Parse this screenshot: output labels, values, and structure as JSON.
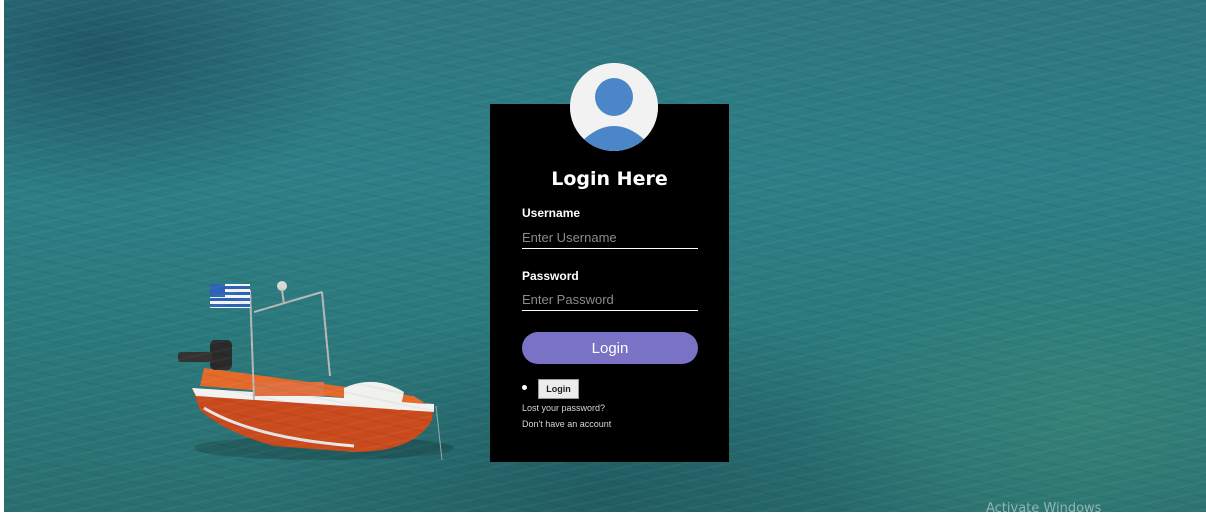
{
  "login": {
    "title": "Login Here",
    "username_label": "Username",
    "username_placeholder": "Enter Username",
    "password_label": "Password",
    "password_placeholder": "Enter Password",
    "submit_label": "Login",
    "secondary_button_label": "Login",
    "lost_password_link": "Lost your password?",
    "no_account_link": "Don't have an account",
    "avatar_icon": "user-avatar-icon"
  },
  "colors": {
    "panel_background": "#000000",
    "button_accent": "#7a72c4",
    "avatar_blue": "#4a86c8",
    "water": "#2d7f86"
  },
  "system": {
    "watermark": "Activate Windows"
  }
}
